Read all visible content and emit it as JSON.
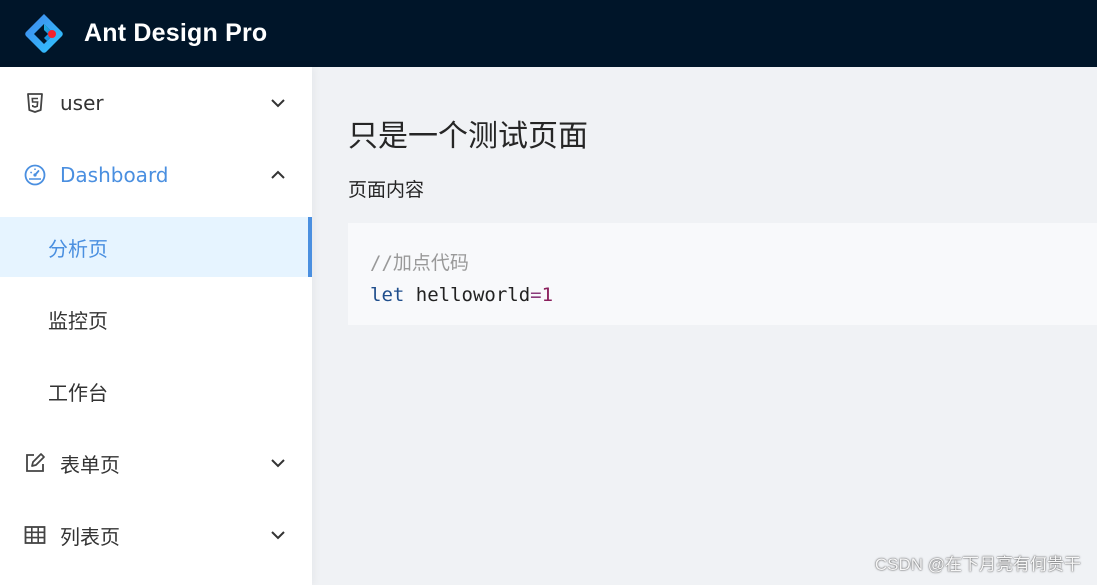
{
  "header": {
    "logo_icon": "ant-design-logo-icon",
    "title": "Ant Design Pro",
    "background": "#001529"
  },
  "sidebar": {
    "accent_color": "#4a8fe0",
    "items": [
      {
        "label": "user",
        "icon": "html5-icon",
        "arrow": "chevron-down-icon",
        "expanded": false
      },
      {
        "label": "Dashboard",
        "icon": "dashboard-gauge-icon",
        "arrow": "chevron-up-icon",
        "expanded": true,
        "children": [
          {
            "label": "分析页",
            "selected": true
          },
          {
            "label": "监控页",
            "selected": false
          },
          {
            "label": "工作台",
            "selected": false
          }
        ]
      },
      {
        "label": "表单页",
        "icon": "form-edit-icon",
        "arrow": "chevron-down-icon",
        "expanded": false
      },
      {
        "label": "列表页",
        "icon": "table-icon",
        "arrow": "chevron-down-icon",
        "expanded": false
      }
    ]
  },
  "main": {
    "title": "只是一个测试页面",
    "description": "页面内容",
    "code": {
      "comment": "//加点代码",
      "keyword": "let",
      "identifier": "helloworld",
      "operator": "=",
      "number": "1"
    }
  },
  "watermark": "CSDN @在下月亮有何贵干"
}
